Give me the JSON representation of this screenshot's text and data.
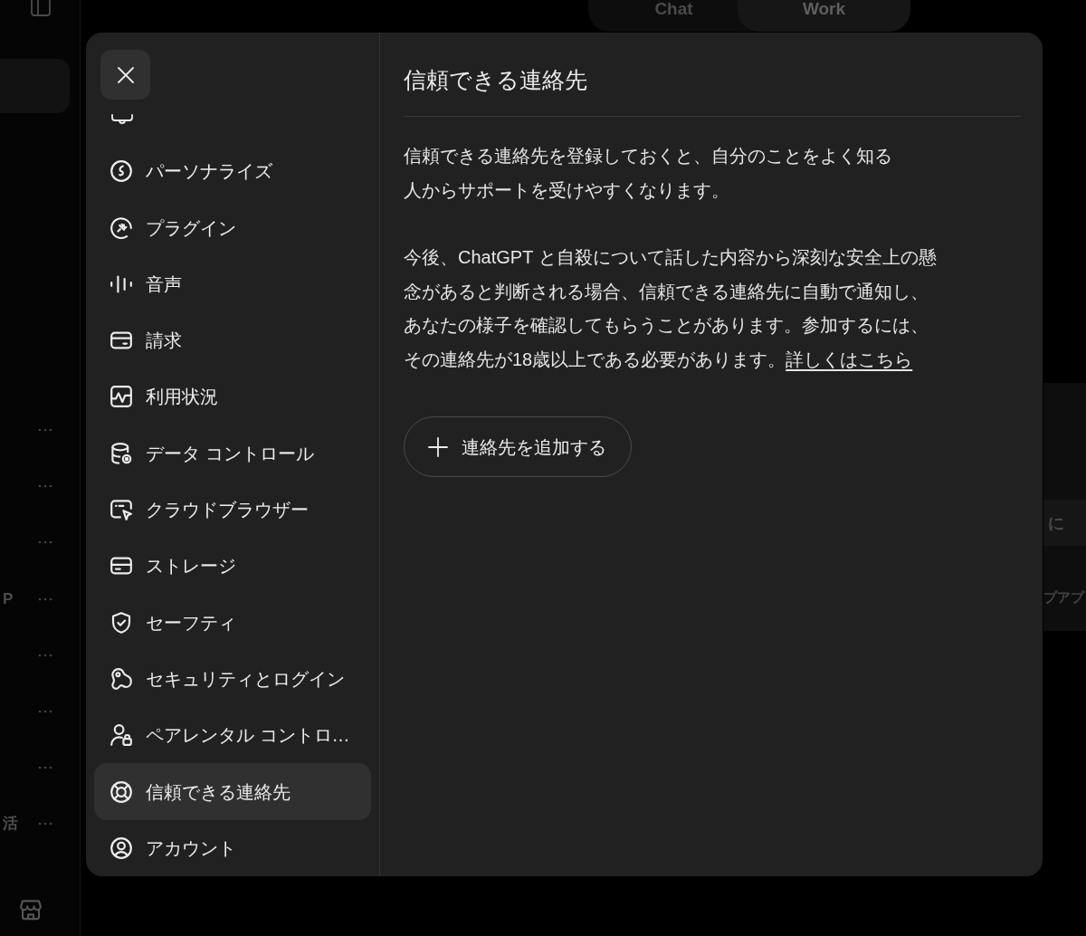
{
  "sidebar": {
    "rows": [
      {},
      {},
      {},
      {
        "text": "P"
      },
      {},
      {},
      {},
      {
        "text": "活"
      }
    ]
  },
  "mode_tabs": [
    {
      "label": "Chat",
      "selected": false
    },
    {
      "label": "Work",
      "selected": true
    }
  ],
  "background_card": {
    "rows": [
      {
        "text": "に"
      },
      {
        "text": "プアプ"
      }
    ]
  },
  "settings_dialog": {
    "nav": {
      "items": [
        {
          "label": "パーソナライズ",
          "selected": false
        },
        {
          "label": "プラグイン",
          "selected": false
        },
        {
          "label": "音声",
          "selected": false
        },
        {
          "label": "請求",
          "selected": false
        },
        {
          "label": "利用状況",
          "selected": false
        },
        {
          "label": "データ コントロール",
          "selected": false
        },
        {
          "label": "クラウドブラウザー",
          "selected": false
        },
        {
          "label": "ストレージ",
          "selected": false
        },
        {
          "label": "セーフティ",
          "selected": false
        },
        {
          "label": "セキュリティとログイン",
          "selected": false
        },
        {
          "label": "ペアレンタル コントロ…",
          "selected": false
        },
        {
          "label": "信頼できる連絡先",
          "selected": true
        },
        {
          "label": "アカウント",
          "selected": false
        }
      ]
    },
    "content": {
      "title": "信頼できる連絡先",
      "paragraphs": [
        {
          "text": "信頼できる連絡先を登録しておくと、自分のことをよく知る人からサポートを受けやすくなります。"
        },
        {
          "text": "今後、ChatGPT と自殺について話した内容から深刻な安全上の懸念があると判断される場合、信頼できる連絡先に自動で通知し、あなたの様子を確認してもらうことがあります。参加するには、その連絡先が18歳以上である必要があります。",
          "link": "詳しくはこちら"
        }
      ],
      "add_button": {
        "label": "連絡先を追加する"
      }
    }
  }
}
